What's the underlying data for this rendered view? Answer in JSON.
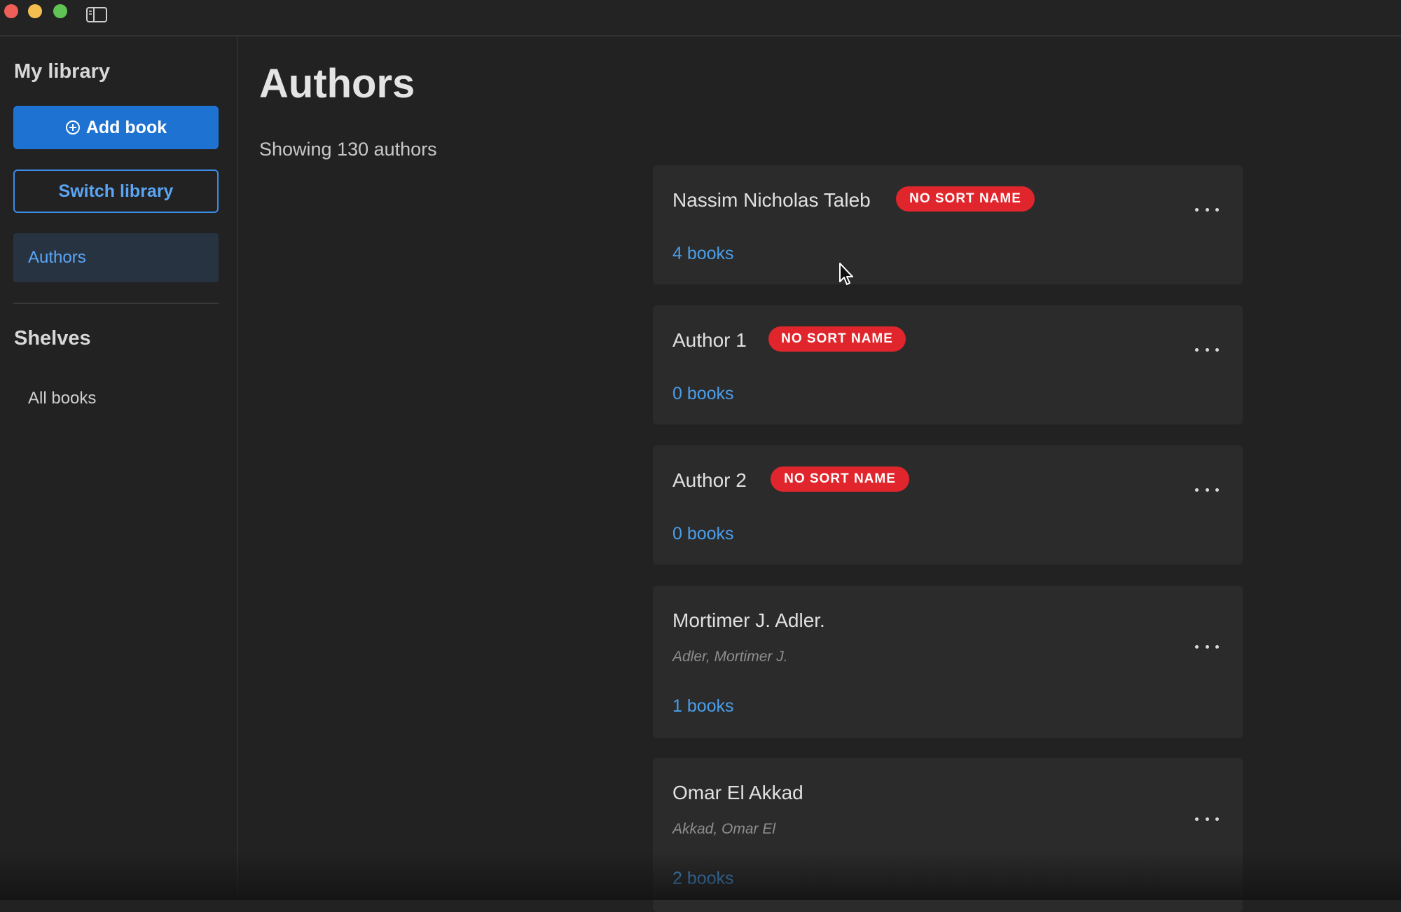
{
  "window": {
    "controls": [
      "close",
      "minimize",
      "maximize"
    ],
    "sidebar_toggle_icon": "sidebar-icon"
  },
  "sidebar": {
    "title": "My library",
    "add_button": "Add book",
    "add_icon": "plus-circle-icon",
    "switch_button": "Switch library",
    "nav_active": "Authors",
    "shelves_title": "Shelves",
    "shelves_items": [
      "All books"
    ]
  },
  "main": {
    "title": "Authors",
    "count_text": "Showing 130 authors",
    "authors": [
      {
        "name": "Nassim Nicholas Taleb",
        "badge": "NO SORT NAME",
        "sort_name": null,
        "books": "4 books"
      },
      {
        "name": "Author 1",
        "badge": "NO SORT NAME",
        "sort_name": null,
        "books": "0 books"
      },
      {
        "name": "Author 2",
        "badge": "NO SORT NAME",
        "sort_name": null,
        "books": "0 books"
      },
      {
        "name": "Mortimer J. Adler.",
        "badge": null,
        "sort_name": "Adler, Mortimer J.",
        "books": "1 books"
      },
      {
        "name": "Omar El Akkad",
        "badge": null,
        "sort_name": "Akkad, Omar El",
        "books": "2 books"
      }
    ]
  },
  "colors": {
    "accent": "#1e73d2",
    "link": "#4a9eea",
    "badge": "#e0262c",
    "background": "#222222",
    "card": "#2b2b2b"
  }
}
